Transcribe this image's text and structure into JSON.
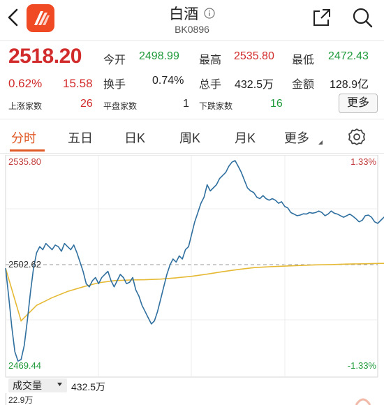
{
  "header": {
    "title": "白酒",
    "code": "BK0896"
  },
  "quote": {
    "price": "2518.20",
    "change_pct": "0.62%",
    "change_amt": "15.58",
    "open_label": "今开",
    "open_value": "2498.99",
    "high_label": "最高",
    "high_value": "2535.80",
    "low_label": "最低",
    "low_value": "2472.43",
    "turnover_label": "换手",
    "turnover_value": "0.74%",
    "volume_label": "总手",
    "volume_value": "432.5万",
    "amount_label": "金额",
    "amount_value": "128.9亿",
    "up_label": "上涨家数",
    "up_value": "26",
    "flat_label": "平盘家数",
    "flat_value": "1",
    "down_label": "下跌家数",
    "down_value": "16",
    "more_label": "更多"
  },
  "tabs": [
    {
      "label": "分时",
      "active": true
    },
    {
      "label": "五日",
      "active": false
    },
    {
      "label": "日K",
      "active": false
    },
    {
      "label": "周K",
      "active": false
    },
    {
      "label": "月K",
      "active": false
    },
    {
      "label": "更多",
      "active": false
    }
  ],
  "chart_data": {
    "type": "line",
    "y_left_max": "2535.80",
    "y_left_mid": "2502.62",
    "y_left_min": "2469.44",
    "y_right_max": "1.33%",
    "y_right_min": "-1.33%",
    "ylim": [
      2469.44,
      2535.8
    ],
    "reference_value": 2502.62,
    "total_points": 240,
    "series": [
      {
        "color": "#2f6f9f",
        "x": [
          0,
          2,
          4,
          6,
          8,
          10,
          12,
          14,
          16,
          18,
          20,
          22,
          24,
          26,
          28,
          30,
          32,
          34,
          36,
          38,
          40,
          42,
          44,
          46,
          48,
          50,
          52,
          54,
          56,
          58,
          60,
          62,
          64,
          66,
          68,
          70,
          72,
          74,
          76,
          78,
          80,
          82,
          84,
          86,
          88,
          90,
          92,
          94,
          96,
          98,
          100,
          102,
          104,
          106,
          108,
          110,
          112,
          114,
          116,
          118,
          120,
          122,
          124,
          126,
          128,
          130,
          132,
          134,
          136,
          138,
          140,
          142,
          144,
          146,
          148,
          150,
          152,
          154,
          156,
          158,
          160,
          162,
          164,
          166,
          168,
          170,
          172,
          174,
          176,
          178,
          180,
          182,
          184,
          186,
          188,
          190,
          192,
          194,
          196,
          198,
          200,
          202,
          204,
          206,
          208,
          210,
          212,
          214,
          216,
          218,
          220,
          222,
          224,
          226,
          228,
          230,
          232,
          234,
          236,
          238,
          240,
          242,
          244,
          246,
          248,
          250
        ],
        "values": [
          2501.0,
          2492.0,
          2482.0,
          2474.0,
          2471.0,
          2471.5,
          2476.0,
          2484.0,
          2493.0,
          2501.0,
          2506.0,
          2508.0,
          2507.0,
          2509.0,
          2508.0,
          2507.0,
          2508.5,
          2508.0,
          2506.5,
          2509.0,
          2508.0,
          2507.0,
          2508.5,
          2506.0,
          2503.0,
          2500.0,
          2496.0,
          2495.0,
          2497.0,
          2498.0,
          2496.0,
          2498.0,
          2499.0,
          2500.0,
          2497.0,
          2495.0,
          2497.0,
          2499.0,
          2498.0,
          2496.0,
          2496.5,
          2498.0,
          2494.0,
          2492.0,
          2489.0,
          2487.0,
          2485.0,
          2483.0,
          2484.0,
          2487.0,
          2491.0,
          2495.0,
          2499.0,
          2502.0,
          2504.0,
          2503.0,
          2505.0,
          2504.0,
          2507.0,
          2508.0,
          2512.0,
          2516.0,
          2519.0,
          2522.0,
          2524.0,
          2528.0,
          2526.0,
          2527.0,
          2528.0,
          2530.0,
          2531.0,
          2532.0,
          2534.0,
          2535.3,
          2535.8,
          2534.0,
          2532.0,
          2529.5,
          2527.0,
          2526.0,
          2525.5,
          2524.0,
          2523.5,
          2524.5,
          2523.5,
          2523.0,
          2523.5,
          2523.0,
          2522.0,
          2522.5,
          2521.0,
          2520.5,
          2519.0,
          2518.5,
          2518.0,
          2518.2,
          2518.6,
          2518.5,
          2519.0,
          2518.8,
          2519.0,
          2519.5,
          2519.0,
          2518.0,
          2518.5,
          2519.5,
          2518.8,
          2518.5,
          2518.0,
          2517.5,
          2518.0,
          2518.5,
          2517.8,
          2517.0,
          2516.0,
          2516.5,
          2518.0,
          2518.2,
          2517.5,
          2516.0,
          2515.5,
          2516.5,
          2517.5,
          2518.0,
          2518.2,
          2518.2
        ]
      },
      {
        "color": "#e6b934",
        "x": [
          0,
          10,
          20,
          30,
          40,
          50,
          60,
          70,
          80,
          90,
          100,
          110,
          120,
          130,
          140,
          150,
          160,
          170,
          180,
          190,
          200,
          210,
          220,
          230,
          240,
          250
        ],
        "values": [
          2501.0,
          2484.0,
          2489.0,
          2491.5,
          2493.5,
          2495.0,
          2496.3,
          2497.0,
          2497.2,
          2497.3,
          2497.5,
          2497.9,
          2498.4,
          2499.1,
          2499.9,
          2500.6,
          2501.2,
          2501.5,
          2501.7,
          2501.9,
          2502.1,
          2502.2,
          2502.35,
          2502.45,
          2502.55,
          2502.62
        ]
      }
    ]
  },
  "volume": {
    "label": "成交量",
    "value": "432.5万",
    "axis_max": "22.9万"
  },
  "icons": {
    "back": "chevron-left-icon",
    "logo": "app-logo-icon",
    "info": "info-circle-icon",
    "share": "share-icon",
    "search": "search-icon",
    "gear": "gear-icon"
  }
}
